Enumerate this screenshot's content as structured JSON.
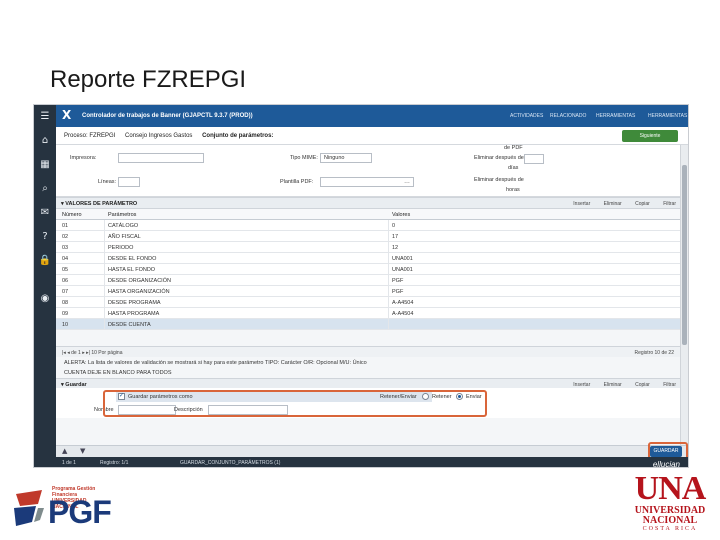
{
  "slide": {
    "title": "Reporte FZREPGI"
  },
  "app": {
    "window_title": "Controlador de trabajos de Banner (GJAPCTL 9.3.7 (PROD))",
    "close_glyph": "X",
    "actions": [
      "ACTIVIDADES",
      "RELACIONADO",
      "HERRAMIENTAS",
      "HERRAMIENTAS"
    ],
    "breadcrumbs": [
      "Proceso: FZREPGI",
      "Consejo Ingresos Gastos",
      "Conjunto de parámetros:"
    ],
    "next_button": "Siguiente",
    "save_button": "GUARDAR",
    "brand": "ellucian"
  },
  "form": {
    "impresora_label": "Impresora:",
    "impresora_value": "",
    "lineas_label": "Líneas:",
    "lineas_value": "",
    "tipo_mime_label": "Tipo MIME:",
    "tipo_mime_value": "Ninguno",
    "plantilla_pdf_label": "Plantilla PDF:",
    "plantilla_pdf_value": "",
    "de_pdf_label": "de PDF",
    "eliminar_label_1": "Eliminar después de",
    "eliminar_label_2": "días",
    "eliminar_value": "",
    "eliminar2_label_1": "Eliminar después de",
    "eliminar2_label_2": "horas"
  },
  "params_section": {
    "title": "VALORES DE PARÁMETRO",
    "tools": [
      "Insertar",
      "Eliminar",
      "Copiar",
      "Filtrar"
    ],
    "headers": [
      "Número",
      "Parámetros",
      "Valores"
    ],
    "rows": [
      [
        "01",
        "CATÁLOGO",
        "0"
      ],
      [
        "02",
        "AÑO FISCAL",
        "17"
      ],
      [
        "03",
        "PERIODO",
        "12"
      ],
      [
        "04",
        "DESDE EL FONDO",
        "UNA001"
      ],
      [
        "05",
        "HASTA EL FONDO",
        "UNA001"
      ],
      [
        "06",
        "DESDE ORGANIZACIÓN",
        "PGF"
      ],
      [
        "07",
        "HASTA ORGANIZACIÓN",
        "PGF"
      ],
      [
        "08",
        "DESDE PROGRAMA",
        "A-A4504"
      ],
      [
        "09",
        "HASTA PROGRAMA",
        "A-A4504"
      ],
      [
        "10",
        "DESDE CUENTA",
        ""
      ]
    ],
    "pager": "de 1",
    "per_page": "10 Por página",
    "record_count": "Registro 10 de 22",
    "note_1": "ALERTA: La lista de valores de validación se mostrará si hay para este parámetro TIPO: Carácter O/R: Opcional M/U: Único",
    "note_2": "CUENTA DEJE EN BLANCO PARA TODOS"
  },
  "saved_section": {
    "title": "Guardar",
    "tools": [
      "Insertar",
      "Eliminar",
      "Copiar",
      "Filtrar"
    ],
    "save_params_label": "Guardar parámetros como",
    "hold_submit_label": "Retener/Enviar",
    "retener_label": "Retener",
    "enviar_label": "Enviar",
    "nombre_label": "Nombre",
    "nombre_value": "",
    "descripcion_label": "Descripción",
    "descripcion_value": ""
  },
  "statusbar": {
    "item_1": "1 de 1",
    "item_2": "Registro: 1/1",
    "item_3": "GUARDAR_CONJUNTO_PARÁMETROS (1)"
  },
  "logos": {
    "pgf_small": "Programa Gestión Financiera UNIVERSIDAD NACIONAL",
    "pgf": "PGF",
    "una": "UNA",
    "una_l1": "UNIVERSIDAD",
    "una_l2": "NACIONAL",
    "una_l3": "COSTA RICA"
  },
  "colors": {
    "accent": "#1e5a99",
    "highlight": "#d9653a",
    "sidebar": "#263340",
    "next": "#3f8a3a"
  }
}
